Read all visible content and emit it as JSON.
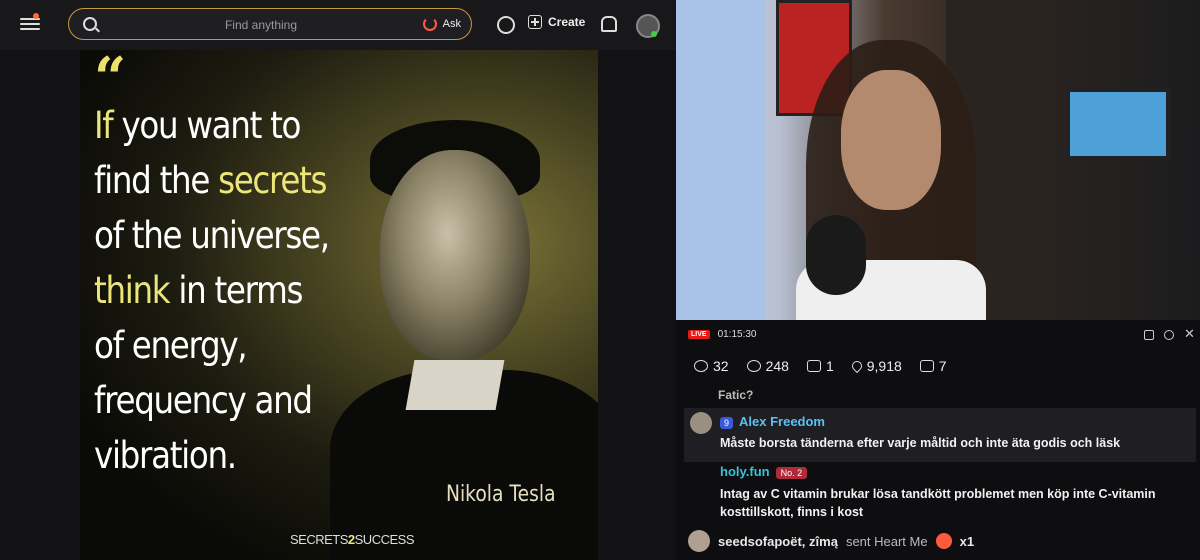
{
  "topbar": {
    "search_placeholder": "Find anything",
    "ask_label": "Ask",
    "create_label": "Create"
  },
  "poster": {
    "quote_lines": [
      {
        "hl": "If",
        "rest": " you want to"
      },
      {
        "pre": "find the ",
        "hl": "secrets"
      },
      {
        "plain": "of the universe,"
      },
      {
        "hl": "think",
        "rest": " in terms"
      },
      {
        "plain": "of energy,"
      },
      {
        "plain": "frequency and"
      },
      {
        "plain": "vibration."
      }
    ],
    "author": "Nikola Tesla",
    "brand_pre": "SECRETS",
    "brand_num": "2",
    "brand_post": "SUCCESS"
  },
  "stream": {
    "live_label": "LIVE",
    "elapsed": "01:15:30",
    "stats": {
      "viewers_group": "32",
      "views": "248",
      "follows": "1",
      "likes": "9,918",
      "gifts": "7"
    }
  },
  "chat": {
    "partial_line": "Fatic?",
    "messages": [
      {
        "badge": "9",
        "user": "Alex Freedom",
        "text": "Måste borsta tänderna efter varje måltid och inte äta godis och läsk"
      },
      {
        "user": "holy.fun",
        "rank": "No. 2",
        "text": "Intag av C vitamin brukar lösa tandkött problemet men köp inte C-vitamin kosttillskott, finns i kost"
      }
    ],
    "gift": {
      "user": "seedsofapoët, zîmą",
      "action": "sent Heart Me",
      "count": "x1"
    }
  }
}
